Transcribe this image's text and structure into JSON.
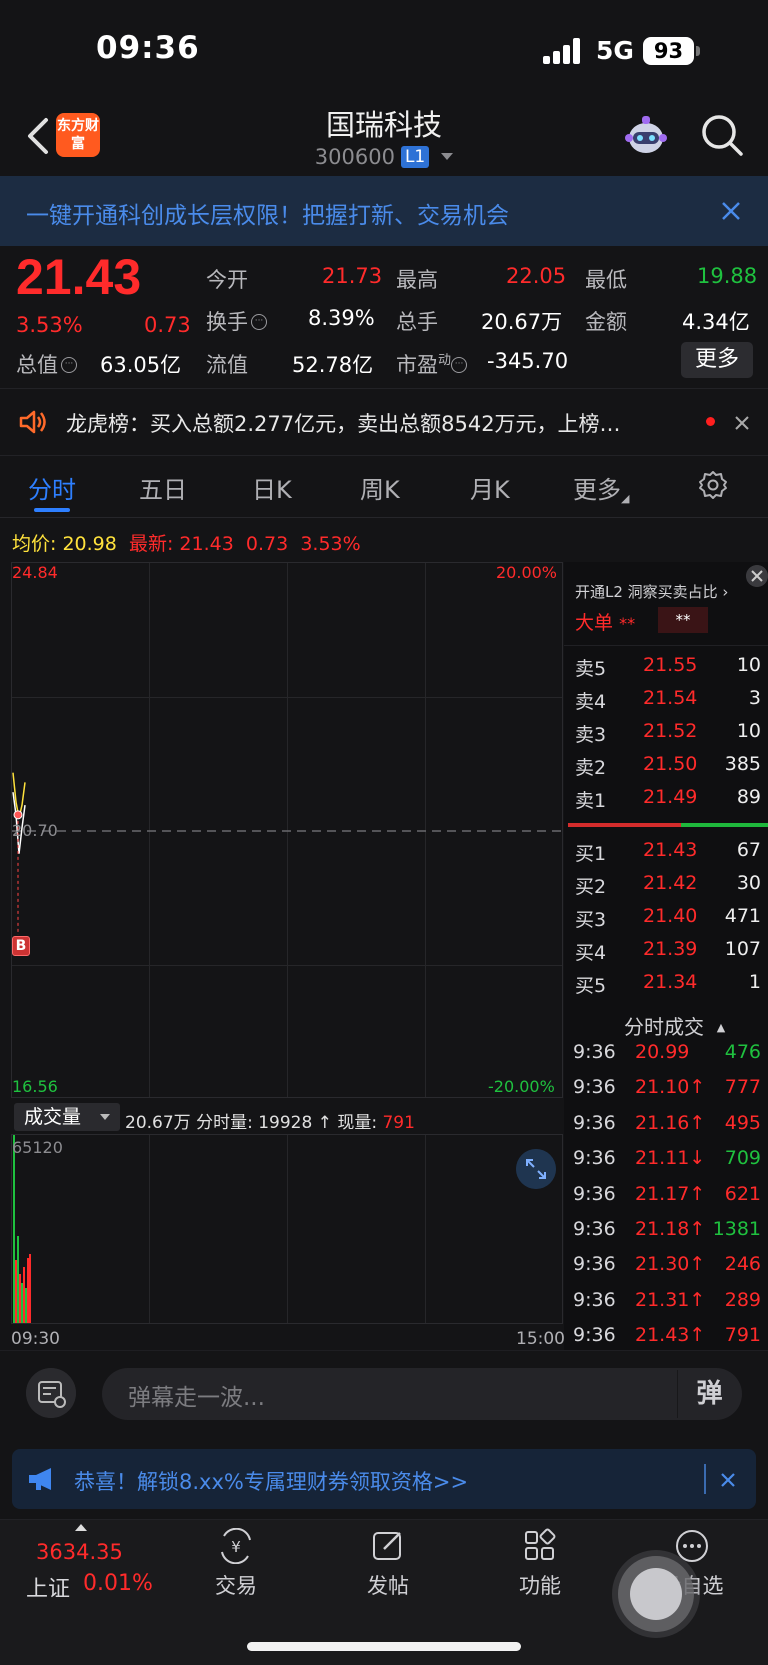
{
  "status_bar": {
    "time": "09:36",
    "network": "5G",
    "battery": "93"
  },
  "nav": {
    "logo_text": "东方财富",
    "stock_name": "国瑞科技",
    "stock_code": "300600",
    "level_badge": "L1"
  },
  "banner": {
    "text": "一键开通科创成长层权限！把握打新、交易机会"
  },
  "quote": {
    "price": "21.43",
    "change_pct": "3.53%",
    "change": "0.73",
    "open_label": "今开",
    "open": "21.73",
    "high_label": "最高",
    "high": "22.05",
    "low_label": "最低",
    "low": "19.88",
    "turnover_label": "换手",
    "turnover": "8.39%",
    "volume_label": "总手",
    "volume": "20.67万",
    "amount_label": "金额",
    "amount": "4.34亿",
    "total_mv_label": "总值",
    "total_mv": "63.05亿",
    "float_mv_label": "流值",
    "float_mv": "52.78亿",
    "pe_label": "市盈",
    "pe_sup": "动",
    "pe": "-345.70",
    "more_label": "更多"
  },
  "news": {
    "text": "龙虎榜：买入总额2.277亿元，卖出总额8542万元，上榜…"
  },
  "tabs": [
    "分时",
    "五日",
    "日K",
    "周K",
    "月K",
    "更多"
  ],
  "chart": {
    "avg_label": "均价:",
    "avg": "20.98",
    "latest_label": "最新:",
    "latest": "21.43",
    "latest_chg": "0.73",
    "latest_pct": "3.53%",
    "y_top": "24.84",
    "y_mid": "20.70",
    "y_bottom": "16.56",
    "pct_top": "20.00%",
    "pct_bottom": "-20.00%",
    "marker": "B",
    "vol_selector": "成交量",
    "vol_summary_prefix": "20.67万 分时量: 19928 ↑ 现量: ",
    "vol_now": "791",
    "vol_max": "65120",
    "time_start": "09:30",
    "time_end": "15:00"
  },
  "chart_data": {
    "type": "line",
    "series": [
      {
        "values": [
          21.3,
          20.95,
          20.35,
          20.75,
          21.1
        ]
      },
      {
        "values": [
          21.6,
          21.15,
          20.9,
          21.1,
          21.45
        ]
      }
    ],
    "ylim": [
      16.56,
      24.84
    ]
  },
  "volume_bars": [
    {
      "v": 65120,
      "c": "#1fc13f"
    },
    {
      "v": 22000,
      "c": "#ff2b2b"
    },
    {
      "v": 30000,
      "c": "#1fc13f"
    },
    {
      "v": 17000,
      "c": "#ff2b2b"
    },
    {
      "v": 14000,
      "c": "#1fc13f"
    },
    {
      "v": 19500,
      "c": "#ff2b2b"
    },
    {
      "v": 12000,
      "c": "#1fc13f"
    },
    {
      "v": 22500,
      "c": "#ff2b2b"
    },
    {
      "v": 24000,
      "c": "#ff2b2b"
    }
  ],
  "orderbook": {
    "l2_text": "开通L2 洞察买卖占比 ›",
    "big_order_label": "大单",
    "big_order_val1": "**",
    "big_order_val2": "**",
    "asks": [
      {
        "label": "卖5",
        "price": "21.55",
        "vol": "10"
      },
      {
        "label": "卖4",
        "price": "21.54",
        "vol": "3"
      },
      {
        "label": "卖3",
        "price": "21.52",
        "vol": "10"
      },
      {
        "label": "卖2",
        "price": "21.50",
        "vol": "385"
      },
      {
        "label": "卖1",
        "price": "21.49",
        "vol": "89"
      }
    ],
    "bids": [
      {
        "label": "买1",
        "price": "21.43",
        "vol": "67"
      },
      {
        "label": "买2",
        "price": "21.42",
        "vol": "30"
      },
      {
        "label": "买3",
        "price": "21.40",
        "vol": "471"
      },
      {
        "label": "买4",
        "price": "21.39",
        "vol": "107"
      },
      {
        "label": "买5",
        "price": "21.34",
        "vol": "1"
      }
    ],
    "trades_title": "分时成交",
    "trades": [
      {
        "time": "9:36",
        "price": "20.99",
        "vol": "476",
        "dir": "green"
      },
      {
        "time": "9:36",
        "price": "21.10↑",
        "vol": "777",
        "dir": "red"
      },
      {
        "time": "9:36",
        "price": "21.16↑",
        "vol": "495",
        "dir": "red"
      },
      {
        "time": "9:36",
        "price": "21.11↓",
        "vol": "709",
        "dir": "green"
      },
      {
        "time": "9:36",
        "price": "21.17↑",
        "vol": "621",
        "dir": "red"
      },
      {
        "time": "9:36",
        "price": "21.18↑",
        "vol": "1381",
        "dir": "green"
      },
      {
        "time": "9:36",
        "price": "21.30↑",
        "vol": "246",
        "dir": "red"
      },
      {
        "time": "9:36",
        "price": "21.31↑",
        "vol": "289",
        "dir": "red"
      },
      {
        "time": "9:36",
        "price": "21.43↑",
        "vol": "791",
        "dir": "red"
      }
    ]
  },
  "danmu": {
    "placeholder": "弹幕走一波...",
    "send": "弹"
  },
  "promo": {
    "text": "恭喜！解锁8.xx%专属理财券领取资格>>"
  },
  "bottom_nav": {
    "index_value": "3634.35",
    "index_name": "上证",
    "index_pct": "0.01%",
    "items": [
      "交易",
      "发帖",
      "功能",
      "设自选"
    ]
  },
  "colors": {
    "up": "#ff2b2b",
    "down": "#1fc13f",
    "accent": "#2e7fff",
    "price_line": "#ffffff",
    "avg_line": "#ffe23c"
  }
}
